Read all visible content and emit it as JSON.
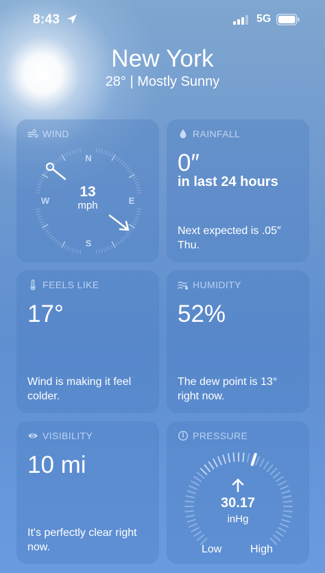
{
  "status": {
    "time": "8:43",
    "network": "5G"
  },
  "header": {
    "city": "New York",
    "subtitle": "28°  |  Mostly Sunny"
  },
  "wind": {
    "title": "WIND",
    "speed": "13",
    "unit": "mph",
    "directions": {
      "n": "N",
      "e": "E",
      "s": "S",
      "w": "W"
    }
  },
  "rainfall": {
    "title": "RAINFALL",
    "value": "0″",
    "period": "in last 24 hours",
    "footer": "Next expected is .05″ Thu."
  },
  "feels_like": {
    "title": "FEELS LIKE",
    "value": "17°",
    "footer": "Wind is making it feel colder."
  },
  "humidity": {
    "title": "HUMIDITY",
    "value": "52%",
    "footer": "The dew point is 13° right now."
  },
  "visibility": {
    "title": "VISIBILITY",
    "value": "10 mi",
    "footer": "It's perfectly clear right now."
  },
  "pressure": {
    "title": "PRESSURE",
    "value": "30.17",
    "unit": "inHg",
    "low_label": "Low",
    "high_label": "High"
  },
  "colors": {
    "card_label": "#c8dcf5",
    "accent": "#ffffff"
  },
  "icons": {
    "location": "location-arrow-icon",
    "wind": "wind-icon",
    "rainfall": "raindrop-icon",
    "feels_like": "thermometer-icon",
    "humidity": "humidity-icon",
    "visibility": "eye-icon",
    "pressure": "gauge-icon"
  }
}
